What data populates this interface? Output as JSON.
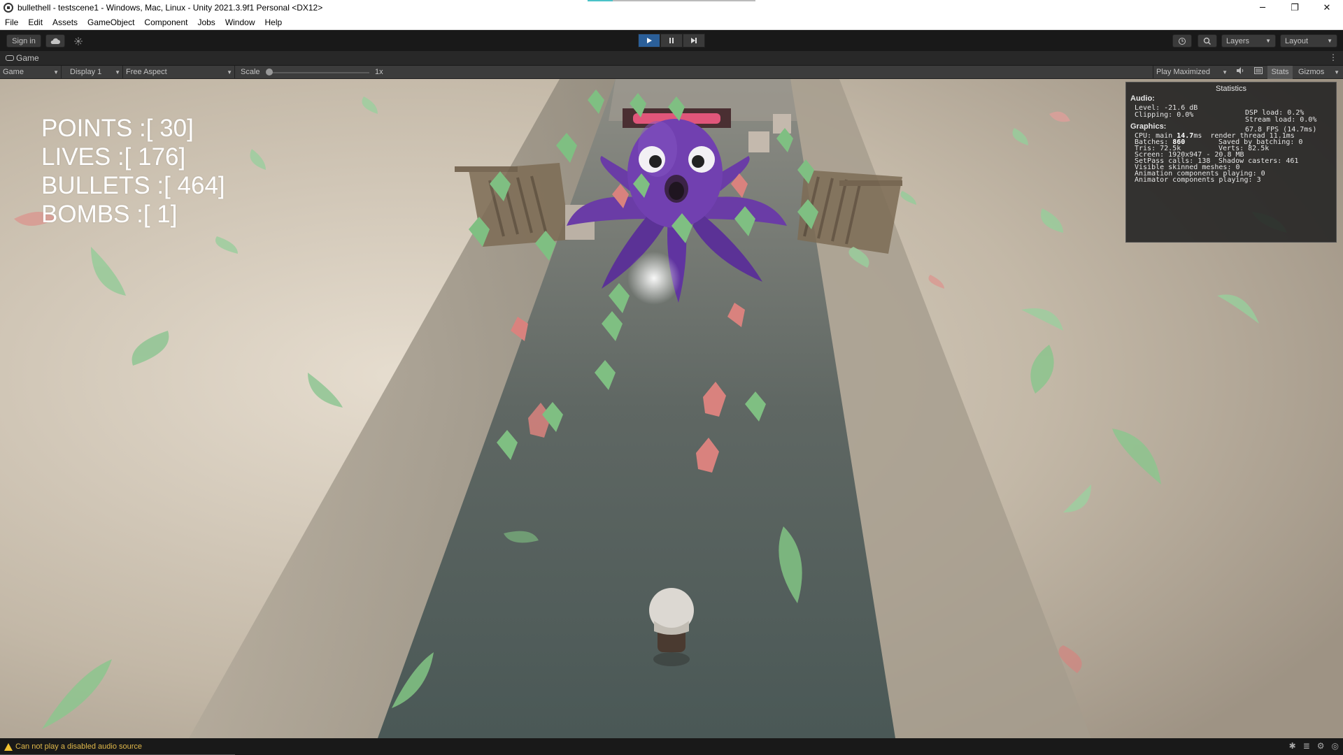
{
  "window": {
    "title": "bullethell - testscene1 - Windows, Mac, Linux - Unity 2021.3.9f1 Personal <DX12>",
    "minimize_glyph": "─",
    "maximize_glyph": "❐",
    "close_glyph": "✕",
    "loading_progress": 0.15
  },
  "menu": [
    "File",
    "Edit",
    "Assets",
    "GameObject",
    "Component",
    "Jobs",
    "Window",
    "Help"
  ],
  "toolbar": {
    "sign_in": "Sign in",
    "layers": "Layers",
    "layout": "Layout",
    "play_state": "playing"
  },
  "tab": {
    "label": "Game"
  },
  "game_toolbar": {
    "view_mode": "Game",
    "display": "Display 1",
    "aspect": "Free Aspect",
    "scale_label": "Scale",
    "scale_value": "1x",
    "play_mode": "Play Maximized",
    "stats": "Stats",
    "gizmos": "Gizmos"
  },
  "hud": {
    "points": "POINTS :[ 30]",
    "lives": "LIVES :[ 176]",
    "bullets": "BULLETS :[ 464]",
    "bombs": "BOMBS :[ 1]"
  },
  "statistics": {
    "title": "Statistics",
    "audio_header": "Audio:",
    "level": "Level: -21.6 dB",
    "clipping": "Clipping: 0.0%",
    "dsp_load": "DSP load: 0.2%",
    "stream_load": "Stream load: 0.0%",
    "graphics_header": "Graphics:",
    "fps": "67.8 FPS (14.7ms)",
    "cpu_label": "CPU: main ",
    "cpu_value": "14.7",
    "cpu_rest": "ms  render thread 11.1ms",
    "batches_label": "Batches: ",
    "batches_value": "860",
    "saved_by_batching": "Saved by batching: 0",
    "tris": "Tris: 72.5k",
    "verts": "Verts: 82.5k",
    "screen": "Screen: 1920x947 - 20.8 MB",
    "setpass": "SetPass calls: 138",
    "shadow_casters": "Shadow casters: 461",
    "visible_skinned": "Visible skinned meshes: 0",
    "animation_components": "Animation components playing: 0",
    "animator_components": "Animator components playing: 3"
  },
  "status": {
    "message": "Can not play a disabled audio source"
  },
  "colors": {
    "accent_play": "#2b5f99",
    "leaf_green": "#7fbf82",
    "leaf_red": "#d9827e",
    "octopus": "#6a3ca6",
    "warning": "#f2c230"
  }
}
